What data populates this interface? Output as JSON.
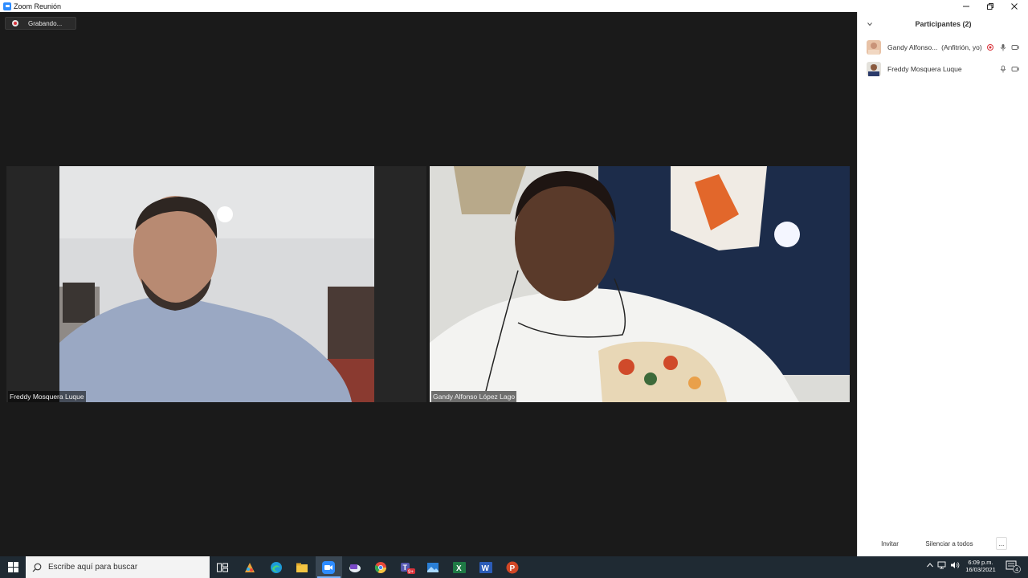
{
  "window": {
    "title": "Zoom Reunión",
    "minimize": "—",
    "restore": "❐",
    "close": "✕"
  },
  "meeting": {
    "recording_label": "Grabando...",
    "tiles": [
      {
        "name": "Freddy Mosquera Luque"
      },
      {
        "name": "Gandy Alfonso López Lago"
      }
    ]
  },
  "participants_panel": {
    "title": "Participantes (2)",
    "participants": [
      {
        "name": "Gandy Alfonso...",
        "role": "(Anfitrión, yo)",
        "icons": [
          "recording-icon",
          "mic-icon",
          "camera-icon"
        ]
      },
      {
        "name": "Freddy Mosquera Luque",
        "role": "",
        "icons": [
          "mic-icon",
          "camera-icon"
        ]
      }
    ],
    "footer": {
      "invite": "Invitar",
      "mute_all": "Silenciar a todos",
      "more": "..."
    }
  },
  "taskbar": {
    "search_placeholder": "Escribe aquí para buscar",
    "time": "6:09 p.m.",
    "date": "16/03/2021",
    "notification_count": "4",
    "teams_badge": "9+",
    "apps": [
      "task-view-icon",
      "paint-icon",
      "edge-icon",
      "file-explorer-icon",
      "zoom-icon",
      "onenote-icon",
      "chrome-icon",
      "teams-icon",
      "photos-icon",
      "excel-icon",
      "word-icon",
      "powerpoint-icon"
    ]
  },
  "colors": {
    "accent": "#2d8cff",
    "recording_red": "#d9323a",
    "taskbar": "#1f2a33",
    "meeting_bg": "#1a1a1a"
  }
}
